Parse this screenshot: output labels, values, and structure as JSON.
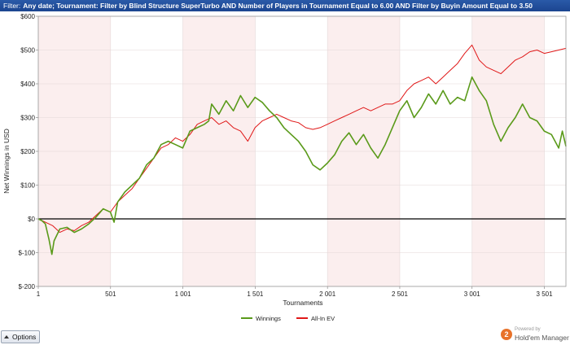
{
  "filter": {
    "label": "Filter:",
    "text": "Any date; Tournament: Filter by Blind Structure  SuperTurbo AND Number of Players in Tournament Equal to 6.00 AND Filter by Buyin Amount Equal to 3.50"
  },
  "chart_data": {
    "type": "line",
    "xlabel": "Tournaments",
    "ylabel": "Net Winnings in USD",
    "xlim": [
      1,
      3650
    ],
    "ylim": [
      -200,
      600
    ],
    "x_ticks": [
      {
        "value": 1,
        "label": "1"
      },
      {
        "value": 501,
        "label": "501"
      },
      {
        "value": 1001,
        "label": "1 001"
      },
      {
        "value": 1501,
        "label": "1 501"
      },
      {
        "value": 2001,
        "label": "2 001"
      },
      {
        "value": 2501,
        "label": "2 501"
      },
      {
        "value": 3001,
        "label": "3 001"
      },
      {
        "value": 3501,
        "label": "3 501"
      }
    ],
    "y_ticks": [
      {
        "value": -200,
        "label": "$-200"
      },
      {
        "value": -100,
        "label": "$-100"
      },
      {
        "value": 0,
        "label": "$0"
      },
      {
        "value": 100,
        "label": "$100"
      },
      {
        "value": 200,
        "label": "$200"
      },
      {
        "value": 300,
        "label": "$300"
      },
      {
        "value": 400,
        "label": "$400"
      },
      {
        "value": 500,
        "label": "$500"
      },
      {
        "value": 600,
        "label": "$600"
      }
    ],
    "legend_position": "bottom-center",
    "series": [
      {
        "name": "Winnings",
        "color": "#5a9a1a",
        "x": [
          1,
          25,
          50,
          75,
          95,
          110,
          150,
          200,
          250,
          300,
          350,
          400,
          450,
          500,
          525,
          550,
          600,
          650,
          700,
          750,
          800,
          850,
          900,
          950,
          1000,
          1050,
          1100,
          1150,
          1180,
          1200,
          1250,
          1300,
          1350,
          1400,
          1450,
          1500,
          1550,
          1600,
          1650,
          1700,
          1750,
          1800,
          1850,
          1900,
          1950,
          2000,
          2050,
          2100,
          2150,
          2200,
          2250,
          2300,
          2350,
          2400,
          2450,
          2500,
          2550,
          2600,
          2650,
          2700,
          2750,
          2800,
          2850,
          2900,
          2950,
          3000,
          3050,
          3100,
          3150,
          3200,
          3250,
          3300,
          3350,
          3400,
          3450,
          3500,
          3550,
          3600,
          3625,
          3650
        ],
        "y": [
          0,
          -5,
          -15,
          -60,
          -105,
          -65,
          -30,
          -25,
          -40,
          -30,
          -15,
          5,
          30,
          20,
          -10,
          50,
          80,
          100,
          120,
          160,
          180,
          220,
          230,
          220,
          210,
          260,
          270,
          280,
          290,
          340,
          310,
          350,
          320,
          365,
          330,
          360,
          345,
          320,
          300,
          270,
          250,
          230,
          200,
          160,
          145,
          165,
          190,
          230,
          255,
          220,
          250,
          210,
          180,
          220,
          270,
          320,
          350,
          300,
          330,
          370,
          340,
          380,
          340,
          360,
          350,
          420,
          380,
          350,
          280,
          230,
          270,
          300,
          340,
          300,
          290,
          260,
          250,
          210,
          260,
          215
        ]
      },
      {
        "name": "All-In EV",
        "color": "#e01818",
        "x": [
          1,
          50,
          100,
          150,
          200,
          250,
          300,
          350,
          400,
          450,
          500,
          550,
          600,
          650,
          700,
          750,
          800,
          850,
          900,
          950,
          1000,
          1050,
          1100,
          1150,
          1200,
          1250,
          1300,
          1350,
          1400,
          1450,
          1500,
          1550,
          1600,
          1650,
          1700,
          1750,
          1800,
          1850,
          1900,
          1950,
          2000,
          2050,
          2100,
          2150,
          2200,
          2250,
          2300,
          2350,
          2400,
          2450,
          2500,
          2550,
          2600,
          2650,
          2700,
          2750,
          2800,
          2850,
          2900,
          2950,
          3000,
          3050,
          3100,
          3150,
          3200,
          3250,
          3300,
          3350,
          3400,
          3450,
          3500,
          3550,
          3600,
          3650
        ],
        "y": [
          0,
          -10,
          -20,
          -40,
          -30,
          -35,
          -20,
          -10,
          10,
          30,
          20,
          50,
          70,
          90,
          120,
          150,
          180,
          210,
          220,
          240,
          230,
          250,
          280,
          290,
          300,
          280,
          290,
          270,
          260,
          230,
          270,
          290,
          300,
          310,
          300,
          290,
          285,
          270,
          265,
          270,
          280,
          290,
          300,
          310,
          320,
          330,
          320,
          330,
          340,
          340,
          350,
          380,
          400,
          410,
          420,
          400,
          420,
          440,
          460,
          490,
          515,
          470,
          450,
          440,
          430,
          450,
          470,
          480,
          495,
          500,
          490,
          495,
          500,
          505
        ]
      }
    ]
  },
  "options": {
    "label": "Options"
  },
  "brand": {
    "powered": "Powered by",
    "name": "Hold'em Manager",
    "logo": "2"
  }
}
